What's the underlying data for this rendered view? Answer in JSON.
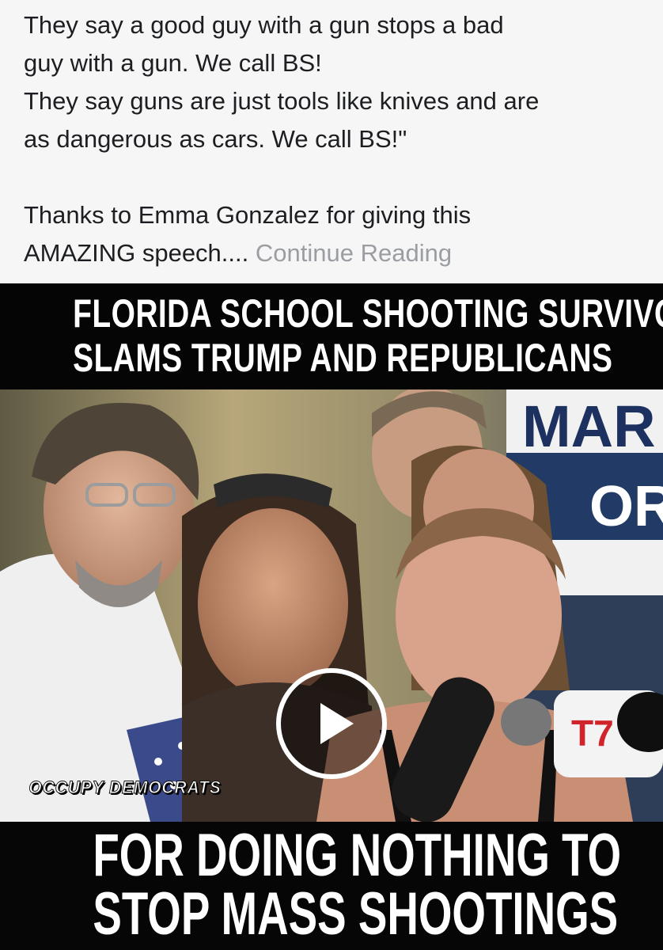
{
  "post": {
    "lines": [
      "They say a good guy with a gun stops a bad",
      "guy with a gun. We call BS!",
      "They say guns are just tools like knives and are",
      "as dangerous as cars. We call BS!\""
    ],
    "thanks_text": "Thanks to Emma Gonzalez for giving this",
    "second_line_text": "AMAZING speech....",
    "continue_link": "Continue Reading"
  },
  "video": {
    "headline_top_1": "FLORIDA SCHOOL SHOOTING SURVIVOR",
    "headline_top_2": "SLAMS TRUMP AND REPUBLICANS",
    "headline_bottom_1": "FOR DOING NOTHING TO",
    "headline_bottom_2": "STOP MASS SHOOTINGS",
    "watermark": "OCCUPY DEMOCRATS",
    "sign_text": "MAR",
    "sign_text_2": "OR",
    "play_icon": "play-icon"
  },
  "colors": {
    "text": "#1c1e21",
    "link": "#9a9da2",
    "background": "#f6f6f6"
  }
}
